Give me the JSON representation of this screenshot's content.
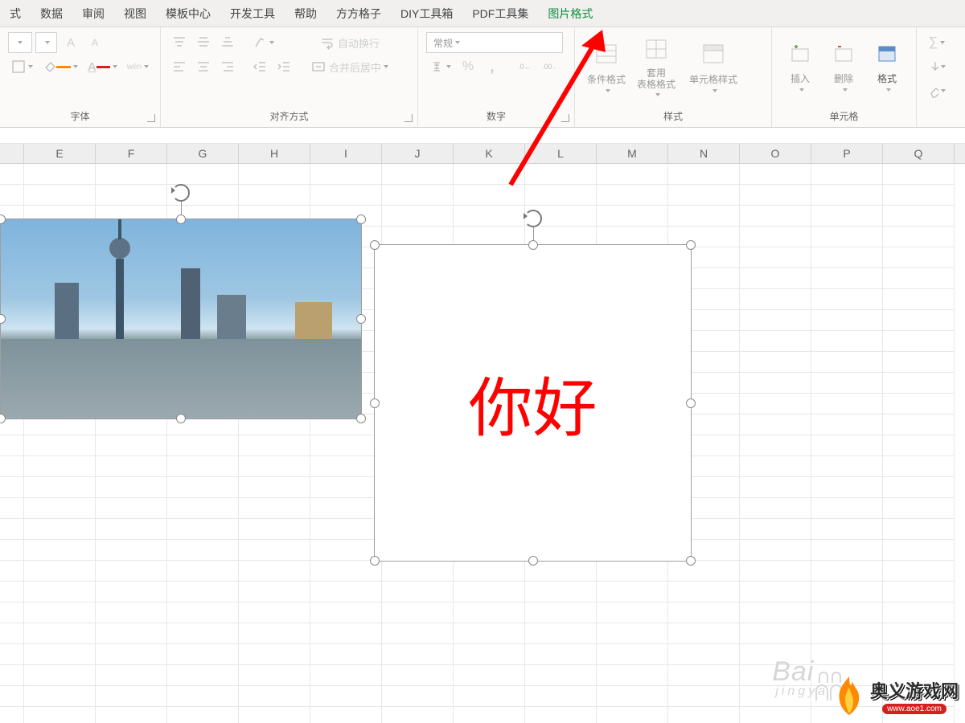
{
  "menu": {
    "items": [
      "式",
      "数据",
      "审阅",
      "视图",
      "模板中心",
      "开发工具",
      "帮助",
      "方方格子",
      "DIY工具箱",
      "PDF工具集",
      "图片格式"
    ],
    "activeIndex": 10
  },
  "ribbon": {
    "font": {
      "label": "字体",
      "bigA": "A",
      "smallA": "A",
      "wen": "wén",
      "underlineColor": "#ff8a00",
      "fontColor": "#d62020"
    },
    "align": {
      "label": "对齐方式",
      "wrap": "自动换行",
      "merge": "合并后居中"
    },
    "number": {
      "label": "数字",
      "formatSelected": "常规",
      "percent": "%",
      "comma": ","
    },
    "styles": {
      "label": "样式",
      "cond": "条件格式",
      "tablefmt": "套用\n表格格式",
      "cellstyle": "单元格样式"
    },
    "cells": {
      "label": "单元格",
      "insert": "插入",
      "delete": "删除",
      "format": "格式"
    }
  },
  "columns": [
    "",
    "E",
    "F",
    "G",
    "H",
    "I",
    "J",
    "K",
    "L",
    "M",
    "N",
    "O",
    "P",
    "Q"
  ],
  "pictures": {
    "textContent": "你好"
  },
  "watermark": {
    "brand": "Bai",
    "sub": "jingya"
  },
  "sitelogo": {
    "cn": "奥义游戏网",
    "url": "www.aoe1.com"
  }
}
